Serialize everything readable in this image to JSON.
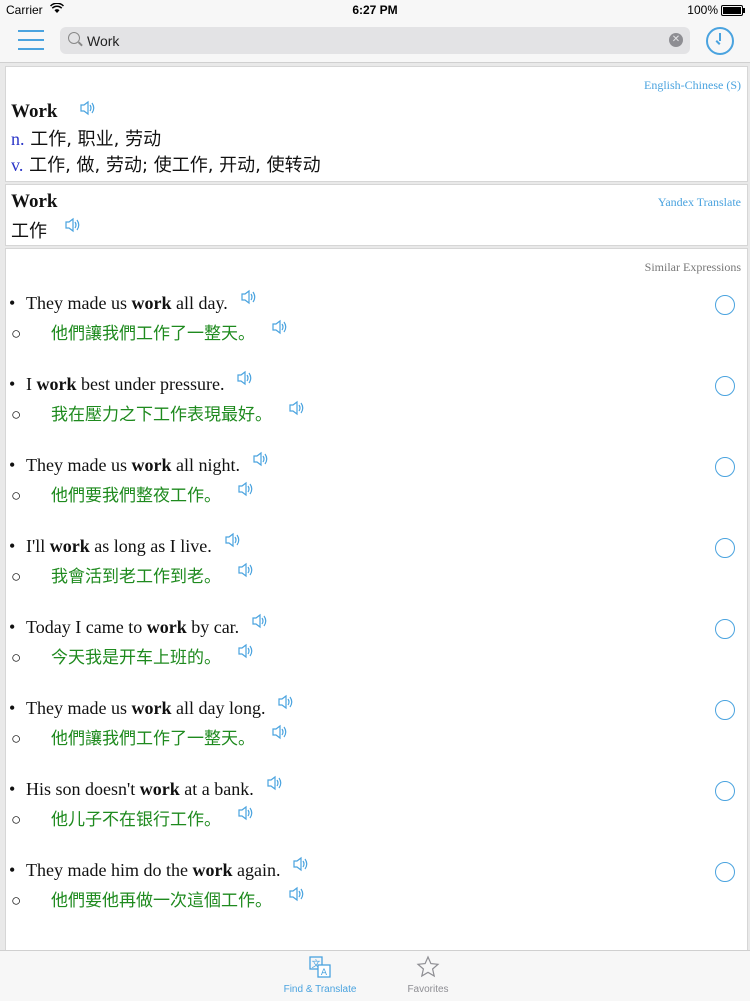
{
  "status_bar": {
    "carrier": "Carrier",
    "time": "6:27 PM",
    "battery": "100%"
  },
  "search": {
    "value": "Work",
    "placeholder": ""
  },
  "dictionary": {
    "source": "English-Chinese (S)",
    "headword": "Work",
    "definitions": [
      {
        "pos": "n.",
        "text": " 工作, 职业, 劳动"
      },
      {
        "pos": "v.",
        "text": " 工作, 做, 劳动; 使工作, 开动, 使转动"
      }
    ]
  },
  "translate": {
    "source": "Yandex Translate",
    "headword": "Work",
    "translation": "工作"
  },
  "similar": {
    "title": "Similar Expressions",
    "items": [
      {
        "pre": "They made us ",
        "key": "work",
        "post": " all day.",
        "zh": "他們讓我們工作了一整天。"
      },
      {
        "pre": "I ",
        "key": "work",
        "post": " best under pressure.",
        "zh": "我在壓力之下工作表現最好。"
      },
      {
        "pre": "They made us ",
        "key": "work",
        "post": " all night.",
        "zh": "他們要我們整夜工作。"
      },
      {
        "pre": "I'll ",
        "key": "work",
        "post": " as long as I live.",
        "zh": "我會活到老工作到老。"
      },
      {
        "pre": "Today I came to ",
        "key": "work",
        "post": " by car.",
        "zh": "今天我是开车上班的。"
      },
      {
        "pre": "They made us ",
        "key": "work",
        "post": " all day long.",
        "zh": "他們讓我們工作了一整天。"
      },
      {
        "pre": "His son doesn't ",
        "key": "work",
        "post": " at a bank.",
        "zh": "他儿子不在银行工作。"
      },
      {
        "pre": "They made him do the ",
        "key": "work",
        "post": " again.",
        "zh": "他們要他再做一次這個工作。"
      }
    ]
  },
  "tabs": [
    {
      "label": "Find & Translate",
      "icon": "translate-icon",
      "active": true
    },
    {
      "label": "Favorites",
      "icon": "star-icon",
      "active": false
    }
  ],
  "colors": {
    "accent": "#4aa3df",
    "chinese_text": "#1e8a1e",
    "pos": "#2b35c8"
  }
}
